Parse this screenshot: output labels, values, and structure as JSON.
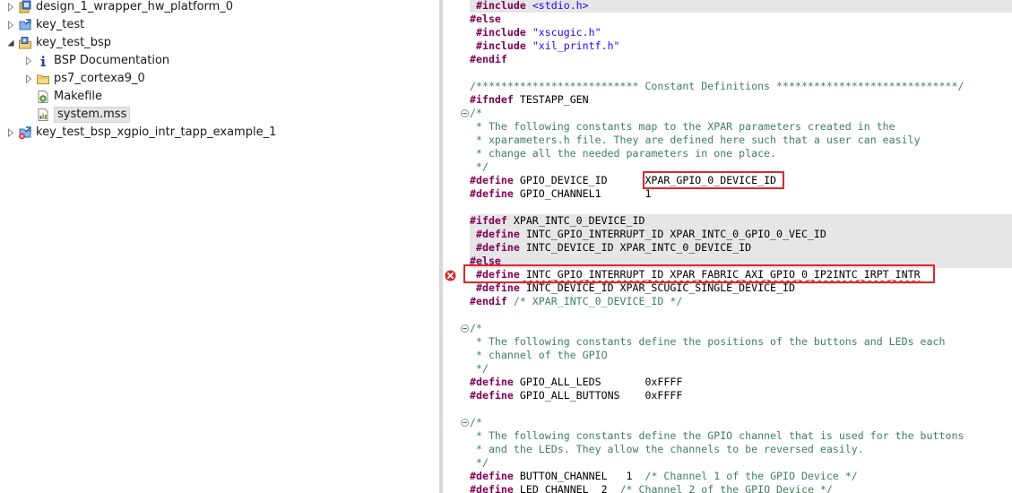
{
  "explorer": {
    "items": [
      {
        "label": "design_1_wrapper_hw_platform_0",
        "icon": "hardware-platform-icon",
        "level": 0,
        "expanded": false
      },
      {
        "label": "key_test",
        "icon": "application-project-icon",
        "level": 0,
        "expanded": false
      },
      {
        "label": "key_test_bsp",
        "icon": "bsp-project-icon",
        "level": 0,
        "expanded": true
      },
      {
        "label": "BSP Documentation",
        "icon": "info-icon",
        "level": 1,
        "expanded": false
      },
      {
        "label": "ps7_cortexa9_0",
        "icon": "folder-icon",
        "level": 1,
        "expanded": false
      },
      {
        "label": "Makefile",
        "icon": "makefile-icon",
        "level": 1,
        "expanded": null
      },
      {
        "label": "system.mss",
        "icon": "mss-file-icon",
        "level": 1,
        "expanded": null,
        "selected": true
      },
      {
        "label": "key_test_bsp_xgpio_intr_tapp_example_1",
        "icon": "application-project-error-icon",
        "level": 0,
        "expanded": false
      }
    ]
  },
  "editor": {
    "lines": [
      {
        "parts": [
          [
            "kw",
            " #include "
          ],
          [
            "str",
            "<stdio.h>"
          ]
        ],
        "hl": true
      },
      {
        "parts": [
          [
            "kw",
            "#else"
          ]
        ]
      },
      {
        "parts": [
          [
            "kw",
            " #include "
          ],
          [
            "str",
            "\"xscugic.h\""
          ]
        ]
      },
      {
        "parts": [
          [
            "kw",
            " #include "
          ],
          [
            "str",
            "\"xil_printf.h\""
          ]
        ]
      },
      {
        "parts": [
          [
            "kw",
            "#endif"
          ]
        ]
      },
      {
        "parts": []
      },
      {
        "parts": [
          [
            "cm",
            "/************************** Constant Definitions *****************************/"
          ]
        ]
      },
      {
        "parts": [
          [
            "kw",
            "#ifndef"
          ],
          [
            "plain",
            " TESTAPP_GEN"
          ]
        ]
      },
      {
        "parts": [
          [
            "cm",
            "/*"
          ]
        ],
        "fold": "minus"
      },
      {
        "parts": [
          [
            "cm",
            " * The following constants map to the XPAR parameters created in the"
          ]
        ]
      },
      {
        "parts": [
          [
            "cm",
            " * xparameters.h file. They are defined here such that a user can easily"
          ]
        ]
      },
      {
        "parts": [
          [
            "cm",
            " * change all the needed parameters in one place."
          ]
        ]
      },
      {
        "parts": [
          [
            "cm",
            " */"
          ]
        ]
      },
      {
        "parts": [
          [
            "kw",
            "#define"
          ],
          [
            "plain",
            " GPIO_DEVICE_ID      XPAR_GPIO_0_DEVICE_ID"
          ]
        ]
      },
      {
        "parts": [
          [
            "kw",
            "#define"
          ],
          [
            "plain",
            " GPIO_CHANNEL1       1"
          ]
        ]
      },
      {
        "parts": []
      },
      {
        "parts": [
          [
            "kw",
            "#ifdef"
          ],
          [
            "plain",
            " XPAR_INTC_0_DEVICE_ID"
          ]
        ],
        "hl": true
      },
      {
        "parts": [
          [
            "kw",
            " #define"
          ],
          [
            "plain",
            " INTC_GPIO_INTERRUPT_ID XPAR_INTC_0_GPIO_0_VEC_ID"
          ]
        ],
        "hl": true
      },
      {
        "parts": [
          [
            "kw",
            " #define"
          ],
          [
            "plain",
            " INTC_DEVICE_ID XPAR_INTC_0_DEVICE_ID"
          ]
        ],
        "hl": true
      },
      {
        "parts": [
          [
            "kw",
            "#else"
          ]
        ],
        "hl": true
      },
      {
        "parts": [
          [
            "kw",
            " #define"
          ],
          [
            "plain",
            " INTC_GPIO_INTERRUPT_ID XPAR_FABRIC_AXI_GPIO_0_IP2INTC_IRPT_INTR"
          ]
        ],
        "error": true
      },
      {
        "parts": [
          [
            "kw",
            " #define"
          ],
          [
            "plain",
            " INTC_DEVICE_ID XPAR_SCUGIC_SINGLE_DEVICE_ID"
          ]
        ]
      },
      {
        "parts": [
          [
            "kw",
            "#endif"
          ],
          [
            "cm",
            " /* XPAR_INTC_0_DEVICE_ID */"
          ]
        ]
      },
      {
        "parts": []
      },
      {
        "parts": [
          [
            "cm",
            "/*"
          ]
        ],
        "fold": "minus"
      },
      {
        "parts": [
          [
            "cm",
            " * The following constants define the positions of the buttons and LEDs each"
          ]
        ]
      },
      {
        "parts": [
          [
            "cm",
            " * channel of the GPIO"
          ]
        ]
      },
      {
        "parts": [
          [
            "cm",
            " */"
          ]
        ]
      },
      {
        "parts": [
          [
            "kw",
            "#define"
          ],
          [
            "plain",
            " GPIO_ALL_LEDS       0xFFFF"
          ]
        ]
      },
      {
        "parts": [
          [
            "kw",
            "#define"
          ],
          [
            "plain",
            " GPIO_ALL_BUTTONS    0xFFFF"
          ]
        ]
      },
      {
        "parts": []
      },
      {
        "parts": [
          [
            "cm",
            "/*"
          ]
        ],
        "fold": "minus"
      },
      {
        "parts": [
          [
            "cm",
            " * The following constants define the GPIO channel that is used for the buttons"
          ]
        ]
      },
      {
        "parts": [
          [
            "cm",
            " * and the LEDs. They allow the channels to be reversed easily."
          ]
        ]
      },
      {
        "parts": [
          [
            "cm",
            " */"
          ]
        ]
      },
      {
        "parts": [
          [
            "kw",
            "#define"
          ],
          [
            "plain",
            " BUTTON_CHANNEL   1  "
          ],
          [
            "cm",
            "/* Channel 1 of the GPIO Device */"
          ]
        ]
      },
      {
        "parts": [
          [
            "kw",
            "#define"
          ],
          [
            "plain",
            " LED_CHANNEL  2  "
          ],
          [
            "cm",
            "/* Channel 2 of the GPIO Device */"
          ]
        ]
      }
    ]
  },
  "colors": {
    "keyword": "#7f0055",
    "string": "#2a00ff",
    "comment": "#3f7f5f",
    "highlight": "#e6e6e6",
    "annotation_box": "#e0262b",
    "error": "#e02020"
  }
}
